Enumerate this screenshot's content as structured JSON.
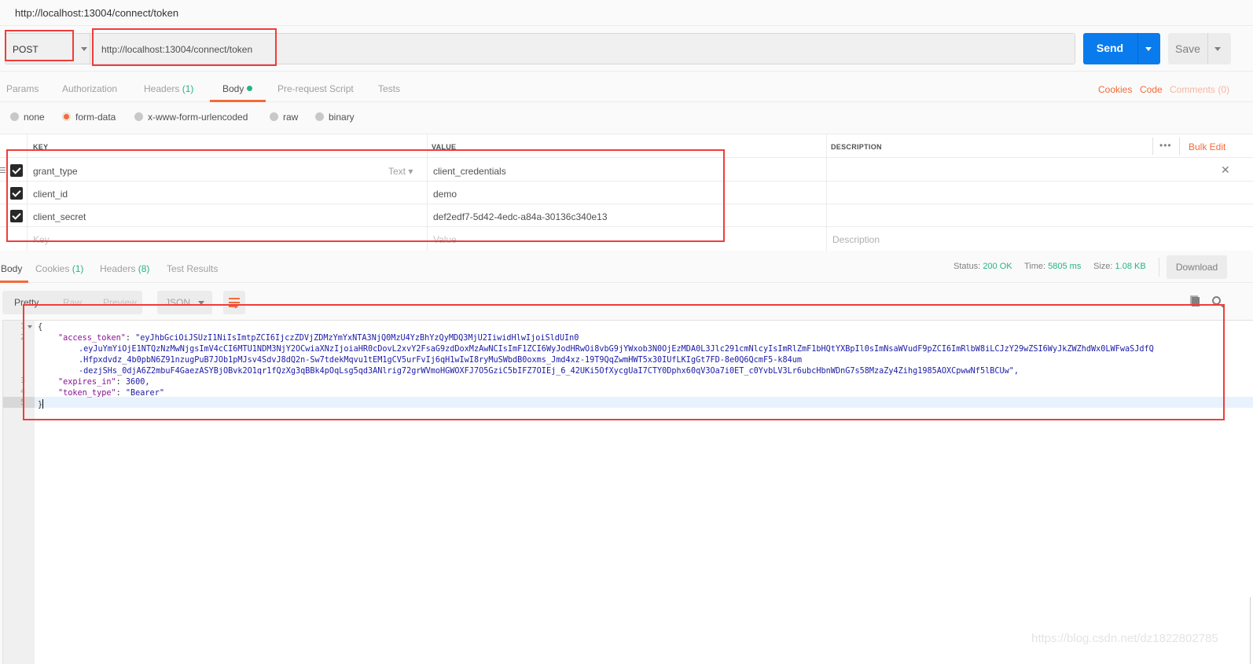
{
  "window": {
    "title": "http://localhost:13004/connect/token"
  },
  "request": {
    "method": "POST",
    "url": "http://localhost:13004/connect/token",
    "send_label": "Send",
    "save_label": "Save"
  },
  "request_tabs": [
    {
      "label": "Params"
    },
    {
      "label": "Authorization"
    },
    {
      "label": "Headers",
      "count": "(1)"
    },
    {
      "label": "Body",
      "active": true
    },
    {
      "label": "Pre-request Script"
    },
    {
      "label": "Tests"
    }
  ],
  "right_links": {
    "cookies": "Cookies",
    "code": "Code",
    "comments": "Comments (0)"
  },
  "body_types": [
    {
      "label": "none",
      "selected": false
    },
    {
      "label": "form-data",
      "selected": true
    },
    {
      "label": "x-www-form-urlencoded",
      "selected": false
    },
    {
      "label": "raw",
      "selected": false
    },
    {
      "label": "binary",
      "selected": false
    }
  ],
  "form_table": {
    "headers": {
      "key": "KEY",
      "value": "VALUE",
      "description": "DESCRIPTION"
    },
    "more_label": "•••",
    "bulk_edit": "Bulk Edit",
    "type_label": "Text",
    "rows": [
      {
        "checked": true,
        "key": "grant_type",
        "value": "client_credentials",
        "description": ""
      },
      {
        "checked": true,
        "key": "client_id",
        "value": "demo",
        "description": ""
      },
      {
        "checked": true,
        "key": "client_secret",
        "value": "def2edf7-5d42-4edc-a84a-30136c340e13",
        "description": ""
      }
    ],
    "placeholders": {
      "key": "Key",
      "value": "Value",
      "description": "Description"
    }
  },
  "response_tabs": [
    {
      "label": "Body",
      "active": true
    },
    {
      "label": "Cookies",
      "count": "(1)"
    },
    {
      "label": "Headers",
      "count": "(8)"
    },
    {
      "label": "Test Results"
    }
  ],
  "response_meta": {
    "status_label": "Status:",
    "status": "200 OK",
    "time_label": "Time:",
    "time": "5805 ms",
    "size_label": "Size:",
    "size": "1.08 KB",
    "download": "Download"
  },
  "view_modes": {
    "pretty": "Pretty",
    "raw": "Raw",
    "preview": "Preview",
    "format": "JSON"
  },
  "response_body": {
    "line_numbers": [
      "1",
      "2",
      "3",
      "4",
      "5"
    ],
    "open_brace": "{",
    "close_brace": "}",
    "access_token_key": "\"access_token\"",
    "access_token_lines": [
      "\"eyJhbGciOiJSUzI1NiIsImtpZCI6IjczZDVjZDMzYmYxNTA3NjQ0MzU4YzBhYzQyMDQ3MjU2IiwidHlwIjoiSldUIn0",
      ".eyJuYmYiOjE1NTQzNzMwNjgsImV4cCI6MTU1NDM3NjY2OCwiaXNzIjoiaHR0cDovL2xvY2FsaG9zdDoxMzAwNCIsImF1ZCI6WyJodHRwOi8vbG9jYWxob3N0OjEzMDA0L3Jlc291cmNlcyIsImRlZmF1bHQtYXBpIl0sImNsaWVudF9pZCI6ImRlbW8iLCJzY29wZSI6WyJkZWZhdWx0LWFwaSJdfQ",
      ".Hfpxdvdz_4b0pbN6Z91nzugPuB7JOb1pMJsv4SdvJ8dQ2n-Sw7tdekMqvu1tEM1gCV5urFvIj6qH1wIwI8ryMuSWbdB0oxms_Jmd4xz-19T9QqZwmHWT5x30IUfLKIgGt7FD-8e0Q6QcmF5-k84um",
      "-dezjSHs_0djA6Z2mbuF4GaezASYBjOBvk2O1qr1fQzXg3qBBk4pOqLsg5qd3ANlrig72grWVmoHGWOXFJ7O5GziC5bIFZ7OIEj_6_42UKi5OfXycgUaI7CTY0Dphx60qV3Oa7i0ET_c0YvbLV3Lr6ubcHbnWDnG7s58MzaZy4Zihg1985AOXCpwwNf5lBCUw\","
    ],
    "expires_in_key": "\"expires_in\"",
    "expires_in_value": "3600,",
    "token_type_key": "\"token_type\"",
    "token_type_value": "\"Bearer\""
  },
  "watermark": "https://blog.csdn.net/dz1822802785"
}
